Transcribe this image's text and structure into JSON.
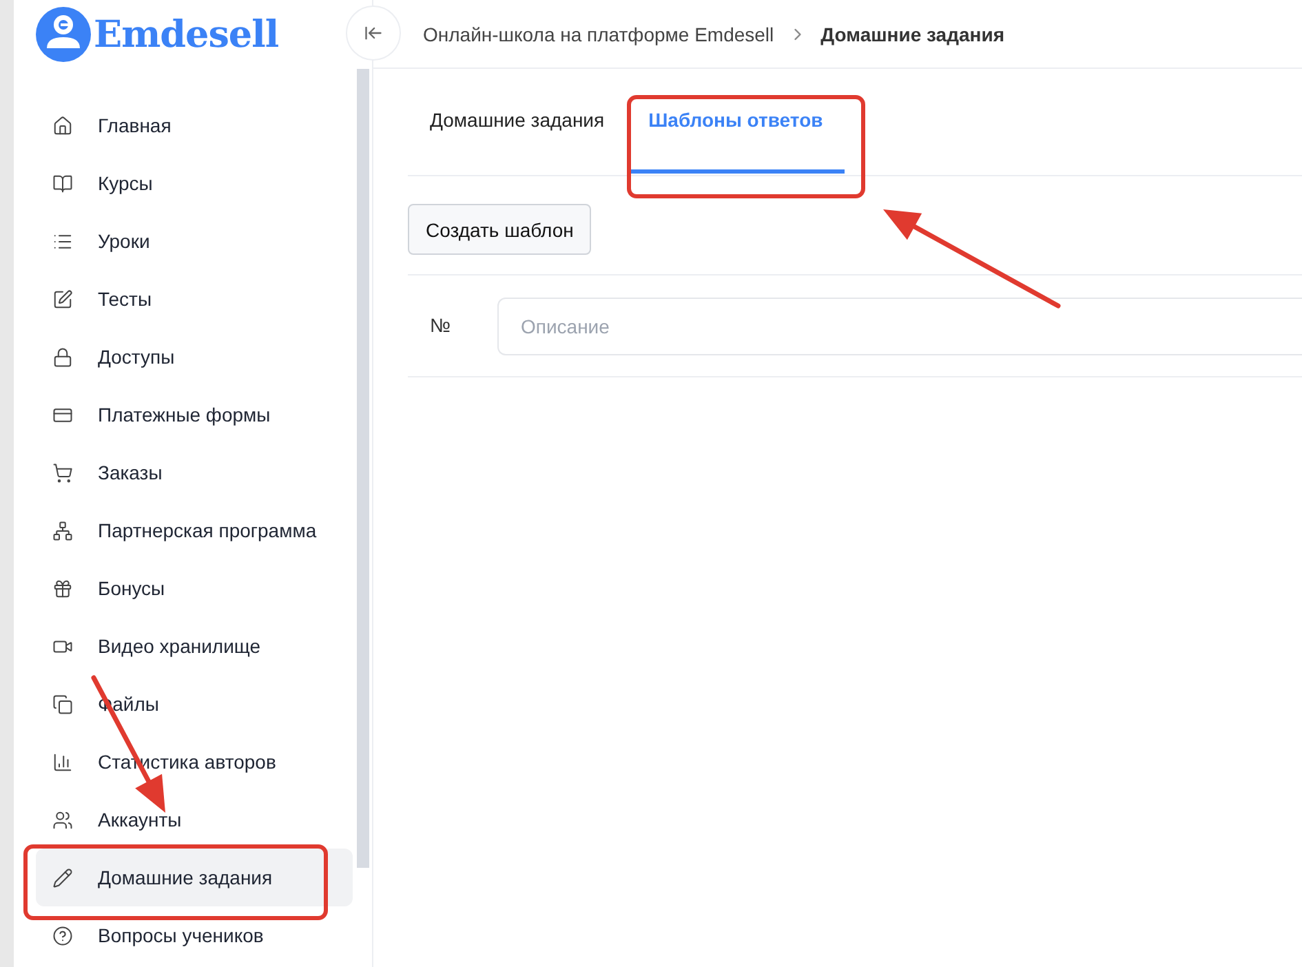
{
  "logo": {
    "text": "Emdesell"
  },
  "sidebar": {
    "items": [
      {
        "label": "Главная",
        "selected": false
      },
      {
        "label": "Курсы",
        "selected": false
      },
      {
        "label": "Уроки",
        "selected": false
      },
      {
        "label": "Тесты",
        "selected": false
      },
      {
        "label": "Доступы",
        "selected": false
      },
      {
        "label": "Платежные формы",
        "selected": false
      },
      {
        "label": "Заказы",
        "selected": false
      },
      {
        "label": "Партнерская программа",
        "selected": false
      },
      {
        "label": "Бонусы",
        "selected": false
      },
      {
        "label": "Видео хранилище",
        "selected": false
      },
      {
        "label": "Файлы",
        "selected": false
      },
      {
        "label": "Статистика авторов",
        "selected": false
      },
      {
        "label": "Аккаунты",
        "selected": false
      },
      {
        "label": "Домашние задания",
        "selected": true
      },
      {
        "label": "Вопросы учеников",
        "selected": false
      }
    ]
  },
  "breadcrumb": [
    "Онлайн-школа на платформе Emdesell",
    "Домашние задания"
  ],
  "tabs": [
    {
      "label": "Домашние задания",
      "selected": false
    },
    {
      "label": "Шаблоны ответов",
      "selected": true
    }
  ],
  "create_button": "Создать шаблон",
  "table": {
    "columns": [
      {
        "label": "№",
        "kind": "text"
      },
      {
        "placeholder": "Описание",
        "kind": "filter"
      }
    ]
  }
}
